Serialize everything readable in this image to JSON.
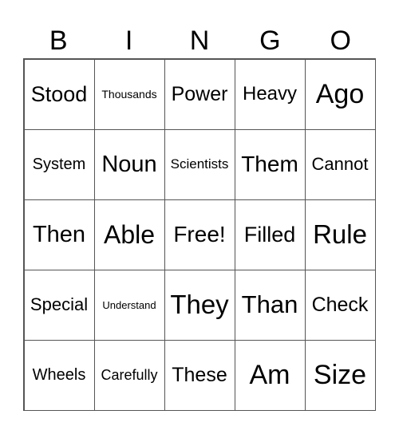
{
  "header": [
    "B",
    "I",
    "N",
    "G",
    "O"
  ],
  "cells": [
    [
      "Stood",
      "Thousands",
      "Power",
      "Heavy",
      "Ago"
    ],
    [
      "System",
      "Noun",
      "Scientists",
      "Them",
      "Cannot"
    ],
    [
      "Then",
      "Able",
      "Free!",
      "Filled",
      "Rule"
    ],
    [
      "Special",
      "Understand",
      "They",
      "Than",
      "Check"
    ],
    [
      "Wheels",
      "Carefully",
      "These",
      "Am",
      "Size"
    ]
  ]
}
